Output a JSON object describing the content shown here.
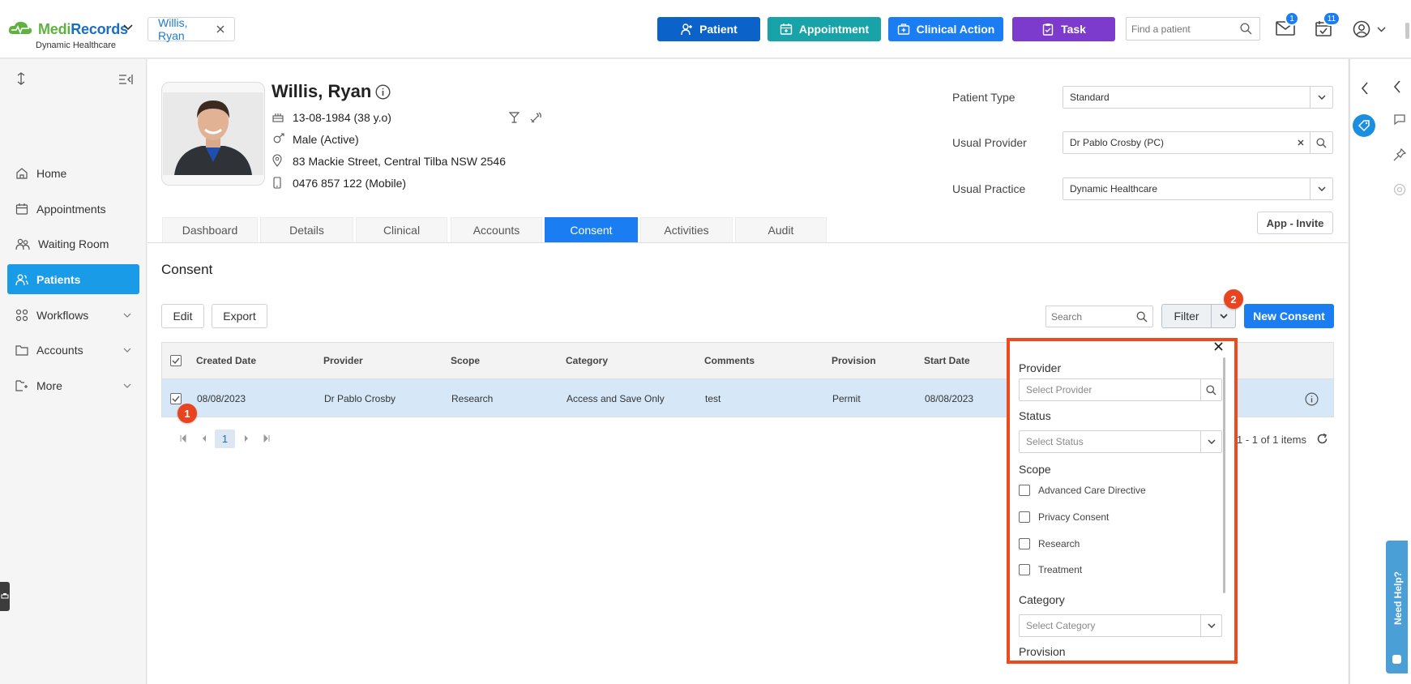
{
  "app": {
    "logo_part1": "Medi",
    "logo_part2": "Records",
    "practice": "Dynamic Healthcare",
    "colors": {
      "brand_green": "#5fb23f",
      "brand_blue": "#1a6fc1",
      "accent": "#1a7ef2",
      "step_badge": "#e8441f"
    }
  },
  "patient_chip": "Willis, Ryan",
  "header_buttons": [
    {
      "label": "Patient",
      "icon": "user-plus-icon",
      "color": "#0b63c9"
    },
    {
      "label": "Appointment",
      "icon": "calendar-plus-icon",
      "color": "#17a3a8"
    },
    {
      "label": "Clinical Action",
      "icon": "medical-case-icon",
      "color": "#1a7ef2"
    },
    {
      "label": "Task",
      "icon": "clipboard-icon",
      "color": "#7c3bcc"
    }
  ],
  "search_patient_placeholder": "Find a patient",
  "badges": {
    "mail": "1",
    "tasks": "11"
  },
  "sidebar": {
    "items": [
      {
        "label": "Home",
        "icon": "home-icon"
      },
      {
        "label": "Appointments",
        "icon": "calendar-icon"
      },
      {
        "label": "Waiting Room",
        "icon": "people-icon"
      },
      {
        "label": "Patients",
        "icon": "patients-icon"
      },
      {
        "label": "Workflows",
        "icon": "workflow-icon"
      },
      {
        "label": "Accounts",
        "icon": "folder-icon"
      },
      {
        "label": "More",
        "icon": "more-icon"
      }
    ]
  },
  "patient": {
    "name": "Willis, Ryan",
    "dob": "13-08-1984 (38 y.o)",
    "gender": "Male (Active)",
    "address": "83 Mackie Street, Central Tilba NSW 2546",
    "phone": "0476 857 122 (Mobile)"
  },
  "patient_fields": {
    "type_label": "Patient Type",
    "type_value": "Standard",
    "provider_label": "Usual Provider",
    "provider_value": "Dr Pablo Crosby (PC)",
    "practice_label": "Usual Practice",
    "practice_value": "Dynamic Healthcare",
    "invite_button": "App - Invite"
  },
  "tabs": [
    "Dashboard",
    "Details",
    "Clinical",
    "Accounts",
    "Consent",
    "Activities",
    "Audit"
  ],
  "active_tab": "Consent",
  "consent": {
    "title": "Consent",
    "edit_button": "Edit",
    "export_button": "Export",
    "search_placeholder": "Search",
    "filter_button": "Filter",
    "new_button": "New Consent",
    "columns": [
      "Created Date",
      "Provider",
      "Scope",
      "Category",
      "Comments",
      "Provision",
      "Start Date"
    ],
    "rows": [
      [
        "08/08/2023",
        "Dr Pablo Crosby",
        "Research",
        "Access and Save Only",
        "test",
        "Permit",
        "08/08/2023"
      ]
    ],
    "pager_current": "1",
    "pager_summary": "1 - 1 of 1 items"
  },
  "step_markers": [
    "1",
    "2"
  ],
  "filter_panel": {
    "provider_label": "Provider",
    "provider_placeholder": "Select Provider",
    "status_label": "Status",
    "status_placeholder": "Select Status",
    "scope_label": "Scope",
    "scope_options": [
      "Advanced Care Directive",
      "Privacy Consent",
      "Research",
      "Treatment"
    ],
    "category_label": "Category",
    "category_placeholder": "Select Category",
    "provision_label": "Provision"
  },
  "help_tab": "Need Help?"
}
